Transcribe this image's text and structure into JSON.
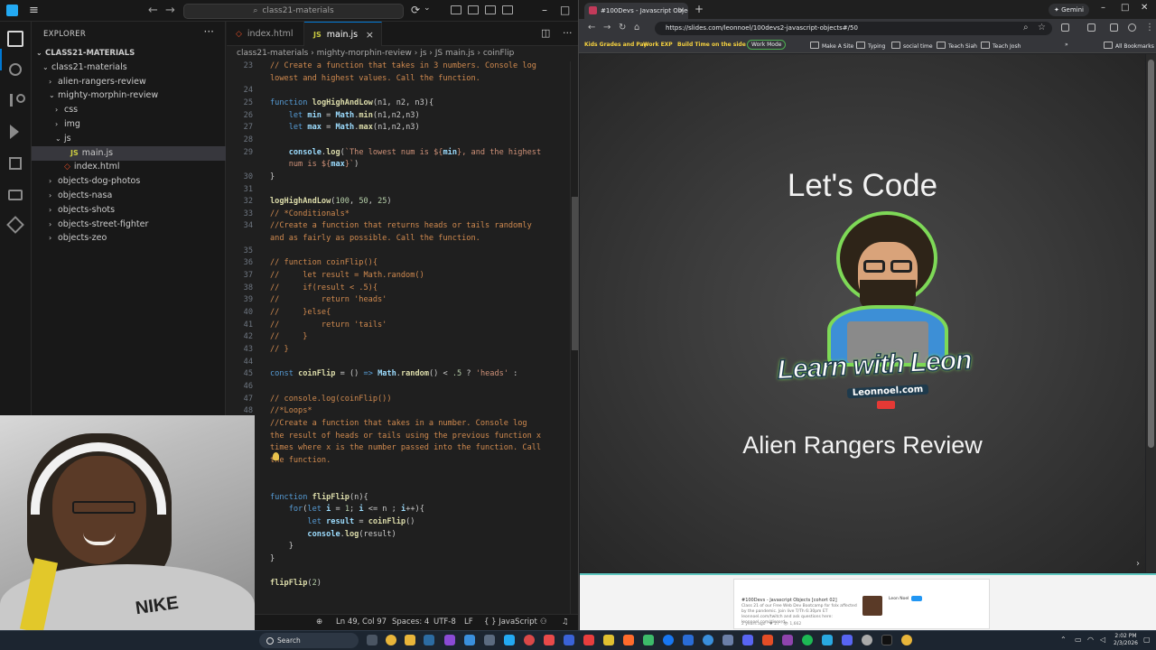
{
  "vscode": {
    "title": {
      "search": "class21-materials",
      "menu_icon": "hamburger-icon"
    },
    "sidebar": {
      "title": "EXPLORER",
      "more": "···",
      "tree": [
        {
          "label": "CLASS21-MATERIALS",
          "chev": "⌄",
          "indent": 0,
          "type": "root"
        },
        {
          "label": "class21-materials",
          "chev": "⌄",
          "indent": 1,
          "type": "folder"
        },
        {
          "label": "alien-rangers-review",
          "chev": "›",
          "indent": 2,
          "type": "folder"
        },
        {
          "label": "mighty-morphin-review",
          "chev": "⌄",
          "indent": 2,
          "type": "folder"
        },
        {
          "label": "css",
          "chev": "›",
          "indent": 3,
          "type": "folder"
        },
        {
          "label": "img",
          "chev": "›",
          "indent": 3,
          "type": "folder"
        },
        {
          "label": "js",
          "chev": "⌄",
          "indent": 3,
          "type": "folder"
        },
        {
          "label": "main.js",
          "chev": "",
          "indent": 4,
          "type": "js",
          "selected": true
        },
        {
          "label": "index.html",
          "chev": "",
          "indent": 3,
          "type": "html"
        },
        {
          "label": "objects-dog-photos",
          "chev": "›",
          "indent": 2,
          "type": "folder"
        },
        {
          "label": "objects-nasa",
          "chev": "›",
          "indent": 2,
          "type": "folder"
        },
        {
          "label": "objects-shots",
          "chev": "›",
          "indent": 2,
          "type": "folder"
        },
        {
          "label": "objects-street-fighter",
          "chev": "›",
          "indent": 2,
          "type": "folder"
        },
        {
          "label": "objects-zeo",
          "chev": "›",
          "indent": 2,
          "type": "folder"
        }
      ]
    },
    "tabs": [
      {
        "label": "index.html",
        "icon": "html-file-icon",
        "active": false
      },
      {
        "label": "main.js",
        "icon": "js-file-icon",
        "active": true,
        "close": "×"
      }
    ],
    "breadcrumb": [
      "class21-materials",
      "mighty-morphin-review",
      "js",
      "JS main.js",
      "coinFlip"
    ],
    "code_lines": [
      {
        "n": "23",
        "html": "<span class='c'>// Create a function that takes in 3 numbers. Console log</span>"
      },
      {
        "n": "",
        "html": "<span class='c'>lowest and highest values. Call the function.</span>"
      },
      {
        "n": "24",
        "html": ""
      },
      {
        "n": "25",
        "html": "<span class='k'>function</span> <span class='f'>logHighAndLow</span>(n1, n2, n3){"
      },
      {
        "n": "26",
        "html": "    <span class='k'>let</span> <span class='v'>min</span> = <span class='v'>Math</span>.<span class='f'>min</span>(n1,n2,n3)"
      },
      {
        "n": "27",
        "html": "    <span class='k'>let</span> <span class='v'>max</span> = <span class='v'>Math</span>.<span class='f'>max</span>(n1,n2,n3)"
      },
      {
        "n": "28",
        "html": ""
      },
      {
        "n": "29",
        "html": "    <span class='v'>console</span>.<span class='f'>log</span>(<span class='s'>`The lowest num is ${</span><span class='v'>min</span><span class='s'>}, and the highest</span>"
      },
      {
        "n": "",
        "html": "    <span class='s'>num is ${</span><span class='v'>max</span><span class='s'>}`</span>)"
      },
      {
        "n": "30",
        "html": "}"
      },
      {
        "n": "31",
        "html": ""
      },
      {
        "n": "32",
        "html": "<span class='f'>logHighAndLow</span>(<span class='n'>100</span>, <span class='n'>50</span>, <span class='n'>25</span>)"
      },
      {
        "n": "33",
        "html": "<span class='c'>// *Conditionals*</span>"
      },
      {
        "n": "34",
        "html": "<span class='c'>//Create a function that returns heads or tails randomly</span>"
      },
      {
        "n": "",
        "html": "<span class='c'>and as fairly as possible. Call the function.</span>"
      },
      {
        "n": "35",
        "html": ""
      },
      {
        "n": "36",
        "html": "<span class='c'>// function coinFlip(){</span>"
      },
      {
        "n": "37",
        "html": "<span class='c'>//     let result = Math.random()</span>"
      },
      {
        "n": "38",
        "html": "<span class='c'>//     if(result &lt; .5){</span>"
      },
      {
        "n": "39",
        "html": "<span class='c'>//         return 'heads'</span>"
      },
      {
        "n": "40",
        "html": "<span class='c'>//     }else{</span>"
      },
      {
        "n": "41",
        "html": "<span class='c'>//         return 'tails'</span>"
      },
      {
        "n": "42",
        "html": "<span class='c'>//     }</span>"
      },
      {
        "n": "43",
        "html": "<span class='c'>// }</span>"
      },
      {
        "n": "44",
        "html": ""
      },
      {
        "n": "45",
        "html": "<span class='k'>const</span> <span class='f'>coinFlip</span> = () <span class='k'>=&gt;</span> <span class='v'>Math</span>.<span class='f'>random</span>() &lt; <span class='n'>.5</span> ? <span class='s'>'heads'</span> :"
      },
      {
        "n": "46",
        "html": ""
      },
      {
        "n": "47",
        "html": "<span class='c'>// console.log(coinFlip())</span>"
      },
      {
        "n": "48",
        "html": "<span class='c'>//*Loops*</span>"
      },
      {
        "n": "49",
        "html": "<span class='c'>//Create a function that takes in a number. Console log</span>",
        "current": true
      },
      {
        "n": "",
        "html": "<span class='c'>the result of heads or tails using the previous function x</span>"
      },
      {
        "n": "",
        "html": "<span class='c'>times where x is the number passed into the function. Call</span>"
      },
      {
        "n": "",
        "html": "<span class='c'>the function.</span>"
      },
      {
        "n": "",
        "html": ""
      },
      {
        "n": "50",
        "html": ""
      },
      {
        "n": "51",
        "html": "<span class='k'>function</span> <span class='f'>flipFlip</span>(n){"
      },
      {
        "n": "52",
        "html": "    <span class='k'>for</span>(<span class='k'>let</span> <span class='v'>i</span> = <span class='n'>1</span>; <span class='v'>i</span> &lt;= n ; <span class='v'>i</span>++){"
      },
      {
        "n": "53",
        "html": "        <span class='k'>let</span> <span class='v'>result</span> = <span class='f'>coinFlip</span>()"
      },
      {
        "n": "54",
        "html": "        <span class='v'>console</span>.<span class='f'>log</span>(result)"
      },
      {
        "n": "55",
        "html": "    }"
      },
      {
        "n": "56",
        "html": "}"
      },
      {
        "n": "57",
        "html": ""
      },
      {
        "n": "58",
        "html": "<span class='f'>flipFlip</span>(<span class='n'>2</span>)"
      }
    ],
    "status": {
      "position": "Ln 49, Col 97",
      "spaces": "Spaces: 4",
      "encoding": "UTF-8",
      "eol": "LF",
      "language": "{ } JavaScript"
    }
  },
  "browser": {
    "tab_title": "#100Devs - Javascript Objects (c",
    "gemini": "✦ Gemini",
    "url": "https://slides.com/leonnoel/100devs2-javascript-objects#/50",
    "bookmarks": [
      {
        "label": "Kids Grades and Pay",
        "style": "y"
      },
      {
        "label": "Work EXP",
        "style": "y"
      },
      {
        "label": "Build Time",
        "style": "y"
      },
      {
        "label": "on the side",
        "style": "y"
      },
      {
        "label": "Work Mode",
        "style": "badge"
      },
      {
        "label": "Make A Site",
        "style": "fold"
      },
      {
        "label": "Typing",
        "style": "fold"
      },
      {
        "label": "social time",
        "style": "fold"
      },
      {
        "label": "Teach Siah",
        "style": "fold"
      },
      {
        "label": "Teach Josh",
        "style": "fold"
      },
      {
        "label": "All Bookmarks",
        "style": "fold"
      }
    ],
    "slide": {
      "heading": "Let's Code",
      "logo_text": "Learn with Leon",
      "logo_site": "Leonnoel.com",
      "subtitle": "Alien Rangers Review"
    },
    "card": {
      "title": "#100Devs - Javascript Objects [cohort 02]",
      "desc": "Class 21 of our Free Web Dev Bootcamp for folx affected by the pandemic. Join live T/Th 6:30pm ET leonnoel.com/twitch and ask questions here: leonnoel.com/discord",
      "meta": "2 years ago · ♥ 27 · 👁 1,662",
      "author": "Leon Noel",
      "badge": "PRO"
    }
  },
  "taskbar": {
    "search": "Search",
    "time": "2:02 PM",
    "date": "2/3/2026"
  },
  "colors": {
    "vscode_bg": "#1f1f1f",
    "accent": "#0078d4",
    "comment": "#d08a4f",
    "keyword": "#569cd6",
    "function": "#dcdcaa",
    "logo_green": "#7ed957"
  }
}
